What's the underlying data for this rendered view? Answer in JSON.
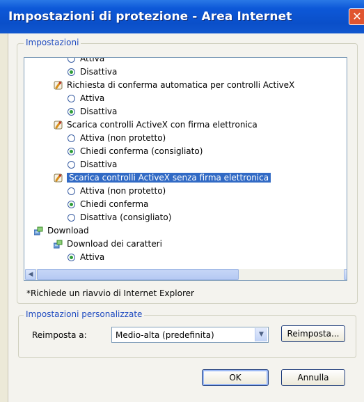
{
  "window": {
    "title": "Impostazioni di protezione - Area Internet",
    "close_glyph": "✕"
  },
  "settings_group": {
    "legend": "Impostazioni"
  },
  "tree": {
    "rows": [
      {
        "kind": "radio",
        "label": "Attiva",
        "checked": false,
        "indent": 1
      },
      {
        "kind": "radio",
        "label": "Disattiva",
        "checked": true,
        "indent": 1
      },
      {
        "kind": "category",
        "label": "Richiesta di conferma automatica per controlli ActiveX",
        "icon": "activex-settings-icon"
      },
      {
        "kind": "radio",
        "label": "Attiva",
        "checked": false,
        "indent": 1
      },
      {
        "kind": "radio",
        "label": "Disattiva",
        "checked": true,
        "indent": 1
      },
      {
        "kind": "category",
        "label": "Scarica controlli ActiveX con firma elettronica",
        "icon": "activex-settings-icon"
      },
      {
        "kind": "radio",
        "label": "Attiva (non protetto)",
        "checked": false,
        "indent": 1
      },
      {
        "kind": "radio",
        "label": "Chiedi conferma (consigliato)",
        "checked": true,
        "indent": 1
      },
      {
        "kind": "radio",
        "label": "Disattiva",
        "checked": false,
        "indent": 1
      },
      {
        "kind": "category",
        "label": "Scarica controlli ActiveX senza firma elettronica",
        "icon": "activex-settings-icon",
        "selected": true
      },
      {
        "kind": "radio",
        "label": "Attiva (non protetto)",
        "checked": false,
        "indent": 1
      },
      {
        "kind": "radio",
        "label": "Chiedi conferma",
        "checked": true,
        "indent": 1
      },
      {
        "kind": "radio",
        "label": "Disattiva (consigliato)",
        "checked": false,
        "indent": 1
      },
      {
        "kind": "category",
        "label": "Download",
        "icon": "download-icon",
        "indent": 0
      },
      {
        "kind": "category",
        "label": "Download dei caratteri",
        "icon": "download-icon"
      },
      {
        "kind": "radio",
        "label": "Attiva",
        "checked": true,
        "indent": 1
      }
    ]
  },
  "restart_note": "*Richiede un riavvio di Internet Explorer",
  "custom_group": {
    "legend": "Impostazioni personalizzate",
    "reset_label": "Reimposta a:",
    "reset_select_value": "Medio-alta (predefinita)",
    "reset_button": "Reimposta..."
  },
  "footer": {
    "ok": "OK",
    "cancel": "Annulla"
  },
  "colors": {
    "titlebar": "#0a4fc9",
    "selection": "#316ac5",
    "group_legend": "#1f4bc0"
  }
}
